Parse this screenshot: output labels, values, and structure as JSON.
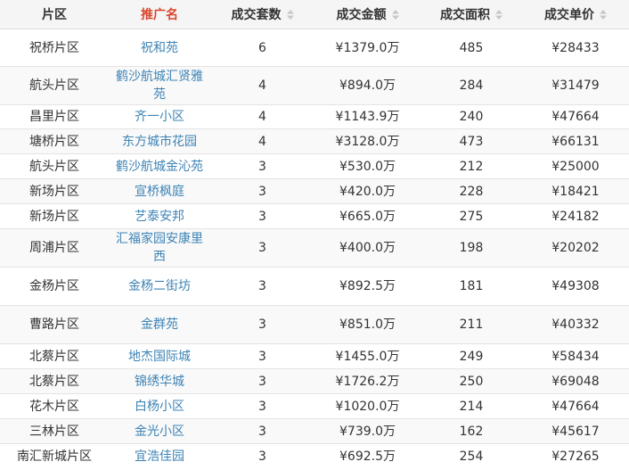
{
  "colors": {
    "header_bg": "#f5f5f5",
    "promo_header": "#d9462c",
    "link": "#3d83b5",
    "border": "#e3e3e3"
  },
  "headers": [
    {
      "label": "片区",
      "sortable": false
    },
    {
      "label": "推广名",
      "sortable": false
    },
    {
      "label": "成交套数",
      "sortable": true,
      "icon": "sort-icon"
    },
    {
      "label": "成交金额",
      "sortable": true,
      "icon": "sort-icon"
    },
    {
      "label": "成交面积",
      "sortable": true,
      "icon": "sort-icon"
    },
    {
      "label": "成交单价",
      "sortable": true,
      "icon": "sort-icon"
    }
  ],
  "rows": [
    {
      "district": "祝桥片区",
      "name": "祝和苑",
      "count": "6",
      "amount": "¥1379.0万",
      "area": "485",
      "price": "¥28433"
    },
    {
      "district": "航头片区",
      "name": "鹤沙航城汇贤雅苑",
      "count": "4",
      "amount": "¥894.0万",
      "area": "284",
      "price": "¥31479"
    },
    {
      "district": "昌里片区",
      "name": "齐一小区",
      "count": "4",
      "amount": "¥1143.9万",
      "area": "240",
      "price": "¥47664"
    },
    {
      "district": "塘桥片区",
      "name": "东方城市花园",
      "count": "4",
      "amount": "¥3128.0万",
      "area": "473",
      "price": "¥66131"
    },
    {
      "district": "航头片区",
      "name": "鹤沙航城金沁苑",
      "count": "3",
      "amount": "¥530.0万",
      "area": "212",
      "price": "¥25000"
    },
    {
      "district": "新场片区",
      "name": "宣桥枫庭",
      "count": "3",
      "amount": "¥420.0万",
      "area": "228",
      "price": "¥18421"
    },
    {
      "district": "新场片区",
      "name": "艺泰安邦",
      "count": "3",
      "amount": "¥665.0万",
      "area": "275",
      "price": "¥24182"
    },
    {
      "district": "周浦片区",
      "name": "汇福家园安康里西",
      "count": "3",
      "amount": "¥400.0万",
      "area": "198",
      "price": "¥20202"
    },
    {
      "district": "金杨片区",
      "name": "金杨二街坊",
      "count": "3",
      "amount": "¥892.5万",
      "area": "181",
      "price": "¥49308"
    },
    {
      "district": "曹路片区",
      "name": "金群苑",
      "count": "3",
      "amount": "¥851.0万",
      "area": "211",
      "price": "¥40332"
    },
    {
      "district": "北蔡片区",
      "name": "地杰国际城",
      "count": "3",
      "amount": "¥1455.0万",
      "area": "249",
      "price": "¥58434"
    },
    {
      "district": "北蔡片区",
      "name": "锦绣华城",
      "count": "3",
      "amount": "¥1726.2万",
      "area": "250",
      "price": "¥69048"
    },
    {
      "district": "花木片区",
      "name": "白杨小区",
      "count": "3",
      "amount": "¥1020.0万",
      "area": "214",
      "price": "¥47664"
    },
    {
      "district": "三林片区",
      "name": "金光小区",
      "count": "3",
      "amount": "¥739.0万",
      "area": "162",
      "price": "¥45617"
    },
    {
      "district": "南汇新城片区",
      "name": "宜浩佳园",
      "count": "3",
      "amount": "¥692.5万",
      "area": "254",
      "price": "¥27265"
    }
  ]
}
